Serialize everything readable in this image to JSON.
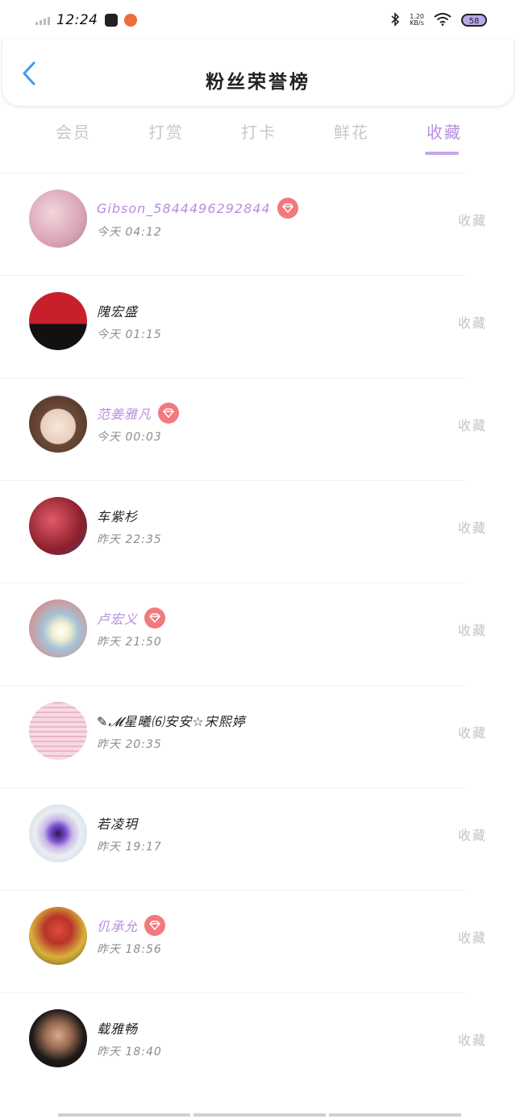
{
  "status_bar": {
    "time": "12:24",
    "net_speed_value": "1.20",
    "net_speed_unit": "KB/s",
    "battery_level": "58",
    "icons": [
      "signal-icon",
      "dice-icon",
      "app-notification-icon",
      "bluetooth-icon",
      "wifi-icon",
      "battery-icon"
    ]
  },
  "header": {
    "title": "粉丝荣誉榜",
    "back_icon": "chevron-left-icon"
  },
  "tabs": [
    {
      "label": "会员",
      "active": false
    },
    {
      "label": "打赏",
      "active": false
    },
    {
      "label": "打卡",
      "active": false
    },
    {
      "label": "鲜花",
      "active": false
    },
    {
      "label": "收藏",
      "active": true
    }
  ],
  "colors": {
    "accent": "#b78ddd",
    "vip_badge": "#f2797d",
    "muted": "#c4c4c4"
  },
  "fans": [
    {
      "name": "Gibson_5844496292844",
      "time": "今天 04:12",
      "vip": true,
      "action": "收藏"
    },
    {
      "name": "隗宏盛",
      "time": "今天 01:15",
      "vip": false,
      "action": "收藏"
    },
    {
      "name": "范姜雅凡",
      "time": "今天 00:03",
      "vip": true,
      "action": "收藏"
    },
    {
      "name": "车紫杉",
      "time": "昨天 22:35",
      "vip": false,
      "action": "收藏"
    },
    {
      "name": "卢宏义",
      "time": "昨天 21:50",
      "vip": true,
      "action": "收藏"
    },
    {
      "name": "✎𝓜星曦⑹安安☆宋熙婷",
      "time": "昨天 20:35",
      "vip": false,
      "action": "收藏"
    },
    {
      "name": "若凌玥",
      "time": "昨天 19:17",
      "vip": false,
      "action": "收藏"
    },
    {
      "name": "仉承允",
      "time": "昨天 18:56",
      "vip": true,
      "action": "收藏"
    },
    {
      "name": "载雅畅",
      "time": "昨天 18:40",
      "vip": false,
      "action": "收藏"
    }
  ]
}
